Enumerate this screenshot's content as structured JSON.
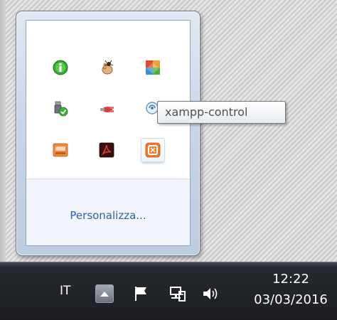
{
  "overflow_flyout": {
    "icons": [
      {
        "name": "info-icon",
        "color": "#2e9d2e"
      },
      {
        "name": "bug-hand-icon",
        "color": "#c8a06a"
      },
      {
        "name": "avg-antivirus-icon",
        "color": "#d84a2a"
      },
      {
        "name": "usb-safely-remove-icon",
        "color": "#5a8f3a"
      },
      {
        "name": "network-tool-icon",
        "color": "#c83a3a"
      },
      {
        "name": "xampp-control-icon",
        "color": "#4a8fcf"
      },
      {
        "name": "drive-storage-icon",
        "color": "#e07b2e"
      },
      {
        "name": "adobe-acrobat-icon",
        "color": "#b0201c"
      },
      {
        "name": "xampp-icon",
        "color": "#e8722a"
      }
    ],
    "customize_label": "Personalizza..."
  },
  "tooltip": {
    "text": "xampp-control"
  },
  "taskbar": {
    "language": "IT",
    "show_hidden_icon": "up-arrow-icon",
    "tray_icons": [
      "action-center-flag-icon",
      "network-icon",
      "volume-icon"
    ],
    "clock": {
      "time": "12:22",
      "date": "03/03/2016"
    }
  }
}
